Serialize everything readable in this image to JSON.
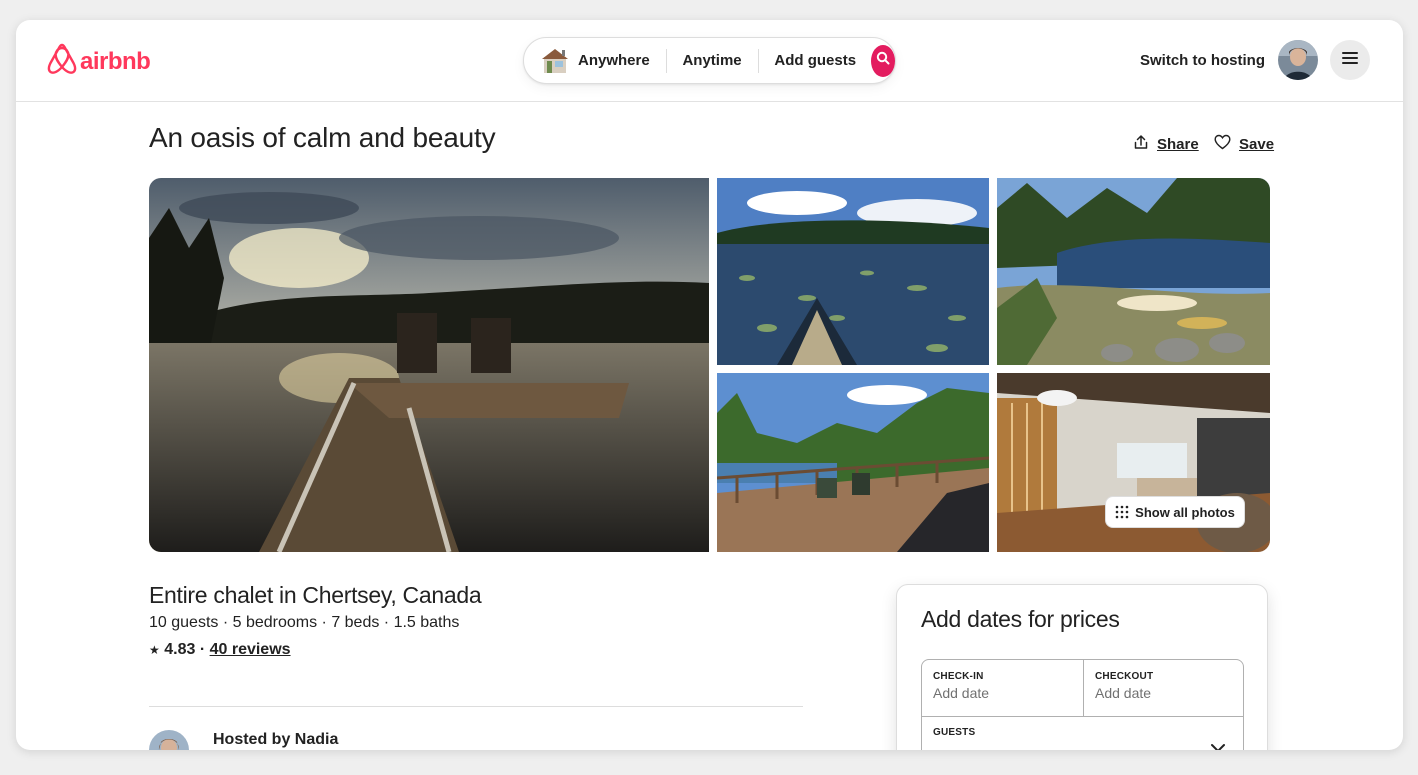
{
  "brand": {
    "name": "airbnb",
    "color": "#ff385c",
    "icon": "airbnb-logo-icon"
  },
  "search": {
    "where": "Anywhere",
    "when": "Anytime",
    "guests": "Add guests",
    "thumbnail_icon": "house-icon",
    "search_icon": "search-icon",
    "accent": "#e31c5f"
  },
  "nav": {
    "switch_to_hosting": "Switch to hosting",
    "menu_icon": "hamburger-icon"
  },
  "listing": {
    "title": "An oasis of calm and beauty",
    "share_label": "Share",
    "save_label": "Save",
    "show_all_photos": "Show all photos",
    "type": "Entire chalet in Chertsey, Canada",
    "details": "10 guests · 5 bedrooms · 7 beds · 1.5 baths",
    "rating_star": "★",
    "rating": "4.83",
    "rating_sep": "·",
    "reviews": "40 reviews",
    "hosted_by": "Hosted by Nadia"
  },
  "photos": [
    {
      "name": "dock-at-sunset-photo"
    },
    {
      "name": "canoe-on-lake-photo"
    },
    {
      "name": "lakeshore-canoes-photo"
    },
    {
      "name": "deck-overlooking-lake-photo"
    },
    {
      "name": "living-room-photo"
    }
  ],
  "booking": {
    "title": "Add dates for prices",
    "checkin_label": "CHECK-IN",
    "checkin_value": "Add date",
    "checkout_label": "CHECKOUT",
    "checkout_value": "Add date",
    "guests_label": "GUESTS"
  }
}
